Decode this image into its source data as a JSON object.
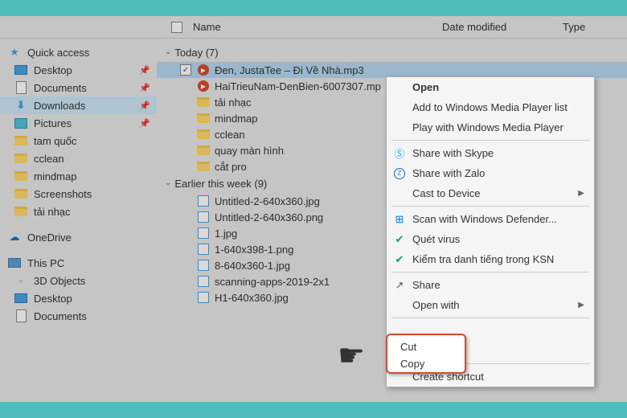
{
  "header": {
    "name": "Name",
    "date": "Date modified",
    "type": "Type"
  },
  "sidebar": {
    "quick_access": "Quick access",
    "items": [
      {
        "label": "Desktop",
        "pin": true,
        "icon": "desktop"
      },
      {
        "label": "Documents",
        "pin": true,
        "icon": "doc"
      },
      {
        "label": "Downloads",
        "pin": true,
        "icon": "dl",
        "selected": true
      },
      {
        "label": "Pictures",
        "pin": true,
        "icon": "pic"
      },
      {
        "label": "tam quốc",
        "pin": false,
        "icon": "folder"
      },
      {
        "label": "cclean",
        "pin": false,
        "icon": "folder"
      },
      {
        "label": "mindmap",
        "pin": false,
        "icon": "folder"
      },
      {
        "label": "Screenshots",
        "pin": false,
        "icon": "folder"
      },
      {
        "label": "tải nhạc",
        "pin": false,
        "icon": "folder"
      }
    ],
    "onedrive": "OneDrive",
    "thispc": "This PC",
    "pc_items": [
      {
        "label": "3D Objects",
        "icon": "3d"
      },
      {
        "label": "Desktop",
        "icon": "desktop"
      },
      {
        "label": "Documents",
        "icon": "doc"
      }
    ]
  },
  "groups": [
    {
      "title": "Today (7)",
      "files": [
        {
          "name": "Đen, JustaTee – Đi Về Nhà.mp3",
          "icon": "mp3",
          "selected": true
        },
        {
          "name": "HaiTrieuNam-DenBien-6007307.mp",
          "icon": "mp3"
        },
        {
          "name": "tải nhạc",
          "icon": "folder"
        },
        {
          "name": "mindmap",
          "icon": "folder"
        },
        {
          "name": "cclean",
          "icon": "folder"
        },
        {
          "name": "quay màn hình",
          "icon": "folder"
        },
        {
          "name": "cắt pro",
          "icon": "folder"
        }
      ]
    },
    {
      "title": "Earlier this week (9)",
      "files": [
        {
          "name": "Untitled-2-640x360.jpg",
          "icon": "img"
        },
        {
          "name": "Untitled-2-640x360.png",
          "icon": "img"
        },
        {
          "name": "1.jpg",
          "icon": "img"
        },
        {
          "name": "1-640x398-1.png",
          "icon": "img"
        },
        {
          "name": "8-640x360-1.jpg",
          "icon": "img"
        },
        {
          "name": "scanning-apps-2019-2x1",
          "icon": "img"
        },
        {
          "name": "H1-640x360.jpg",
          "icon": "img"
        }
      ]
    }
  ],
  "ctx": {
    "open": "Open",
    "wmp_list": "Add to Windows Media Player list",
    "wmp_play": "Play with Windows Media Player",
    "skype": "Share with Skype",
    "zalo": "Share with Zalo",
    "cast": "Cast to Device",
    "defender": "Scan with Windows Defender...",
    "virus": "Quét virus",
    "ksn": "Kiểm tra danh tiếng trong KSN",
    "share": "Share",
    "openwith": "Open with",
    "cut": "Cut",
    "copy": "Copy",
    "shortcut": "Create shortcut"
  }
}
